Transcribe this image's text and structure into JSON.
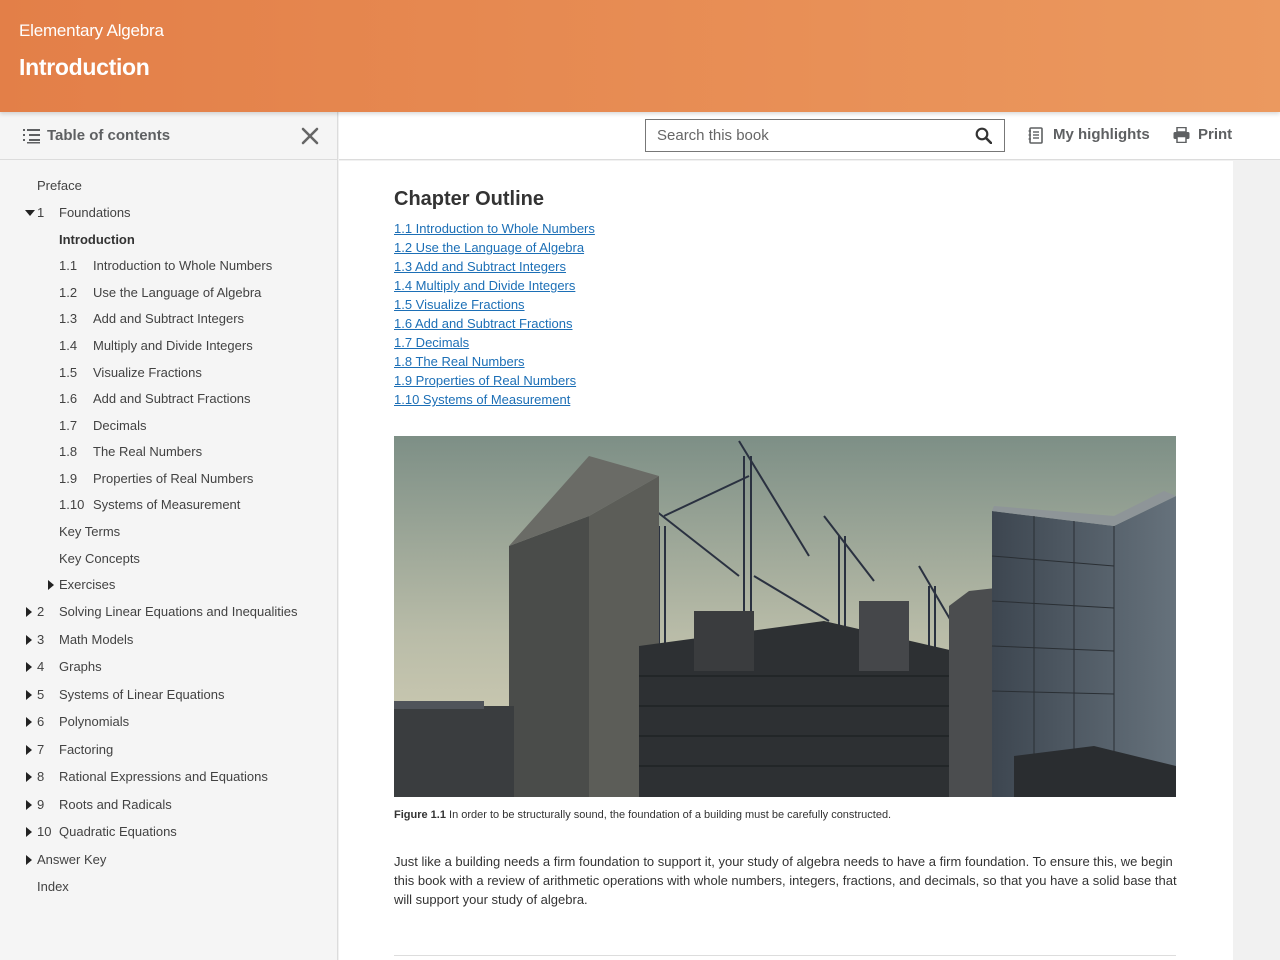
{
  "header": {
    "book_title": "Elementary Algebra",
    "page_title": "Introduction"
  },
  "sidebar": {
    "toc_label": "Table of contents",
    "icons": {
      "list": "list-icon",
      "close": "close-icon"
    },
    "items": [
      {
        "num": "",
        "label": "Preface"
      },
      {
        "num": "1",
        "label": "Foundations",
        "expander": "expanded"
      },
      {
        "num": "",
        "label": "Introduction",
        "active": true
      },
      {
        "num": "1.1",
        "label": "Introduction to Whole Numbers"
      },
      {
        "num": "1.2",
        "label": "Use the Language of Algebra"
      },
      {
        "num": "1.3",
        "label": "Add and Subtract Integers"
      },
      {
        "num": "1.4",
        "label": "Multiply and Divide Integers"
      },
      {
        "num": "1.5",
        "label": "Visualize Fractions"
      },
      {
        "num": "1.6",
        "label": "Add and Subtract Fractions"
      },
      {
        "num": "1.7",
        "label": "Decimals"
      },
      {
        "num": "1.8",
        "label": "The Real Numbers"
      },
      {
        "num": "1.9",
        "label": "Properties of Real Numbers"
      },
      {
        "num": "1.10",
        "label": "Systems of Measurement"
      },
      {
        "num": "",
        "label": "Key Terms"
      },
      {
        "num": "",
        "label": "Key Concepts"
      },
      {
        "num": "",
        "label": "Exercises",
        "expander": "collapsed"
      },
      {
        "num": "2",
        "label": "Solving Linear Equations and Inequalities",
        "expander": "collapsed"
      },
      {
        "num": "3",
        "label": "Math Models",
        "expander": "collapsed"
      },
      {
        "num": "4",
        "label": "Graphs",
        "expander": "collapsed"
      },
      {
        "num": "5",
        "label": "Systems of Linear Equations",
        "expander": "collapsed"
      },
      {
        "num": "6",
        "label": "Polynomials",
        "expander": "collapsed"
      },
      {
        "num": "7",
        "label": "Factoring",
        "expander": "collapsed"
      },
      {
        "num": "8",
        "label": "Rational Expressions and Equations",
        "expander": "collapsed"
      },
      {
        "num": "9",
        "label": "Roots and Radicals",
        "expander": "collapsed"
      },
      {
        "num": "10",
        "label": "Quadratic Equations",
        "expander": "collapsed"
      },
      {
        "num": "",
        "label": "Answer Key",
        "expander": "collapsed"
      },
      {
        "num": "",
        "label": "Index"
      }
    ]
  },
  "toolbar": {
    "search_placeholder": "Search this book",
    "search_value": "",
    "highlights_label": "My highlights",
    "print_label": "Print",
    "icons": {
      "search": "search-icon",
      "highlights": "notebook-icon",
      "print": "printer-icon"
    }
  },
  "main": {
    "outline_heading": "Chapter Outline",
    "outline_links": [
      "1.1 Introduction to Whole Numbers",
      "1.2 Use the Language of Algebra",
      "1.3 Add and Subtract Integers",
      "1.4 Multiply and Divide Integers",
      "1.5 Visualize Fractions",
      "1.6 Add and Subtract Fractions",
      "1.7 Decimals",
      "1.8 The Real Numbers",
      "1.9 Properties of Real Numbers",
      "1.10 Systems of Measurement"
    ],
    "figure_label": "Figure 1.1",
    "figure_caption": " In order to be structurally sound, the foundation of a building must be carefully constructed.",
    "paragraph": "Just like a building needs a firm foundation to support it, your study of algebra needs to have a firm foundation. To ensure this, we begin this book with a review of arithmetic operations with whole numbers, integers, fractions, and decimals, so that you have a solid base that will support your study of algebra."
  },
  "colors": {
    "header_start": "#e37f48",
    "header_end": "#eb995f",
    "link": "#1c6fb6"
  }
}
